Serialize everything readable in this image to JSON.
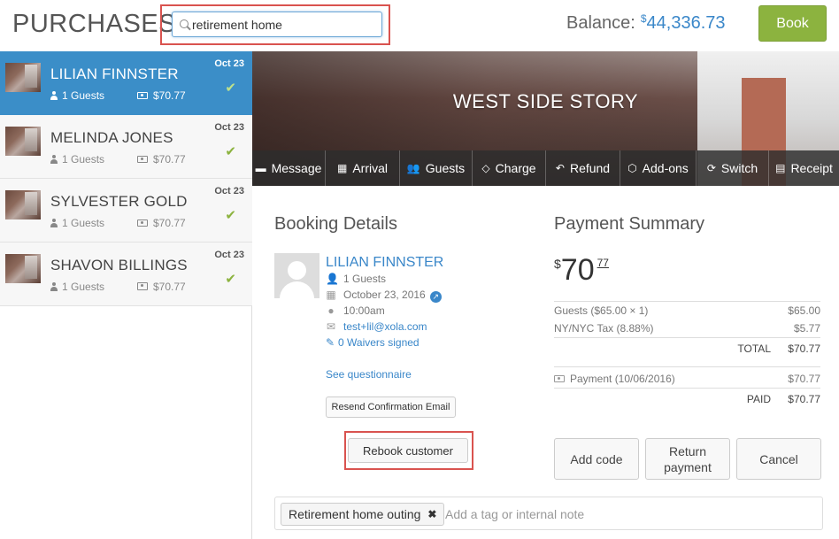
{
  "header": {
    "title": "PURCHASES",
    "search": {
      "value": "retirement home",
      "placeholder": ""
    },
    "balance_label": "Balance:",
    "balance_currency": "$",
    "balance_amount": "44,336.73",
    "book_label": "Book"
  },
  "purchases": [
    {
      "name": "LILIAN FINNSTER",
      "date": "Oct 23",
      "guests": "1 Guests",
      "price": "$70.77",
      "payment_icon": "cash-icon",
      "active": true
    },
    {
      "name": "MELINDA JONES",
      "date": "Oct 23",
      "guests": "1 Guests",
      "price": "$70.77",
      "payment_icon": "cash-icon",
      "active": false
    },
    {
      "name": "SYLVESTER GOLD",
      "date": "Oct 23",
      "guests": "1 Guests",
      "price": "$70.77",
      "payment_icon": "cash-icon",
      "active": false
    },
    {
      "name": "SHAVON BILLINGS",
      "date": "Oct 23",
      "guests": "1 Guests",
      "price": "$70.77",
      "payment_icon": "card-icon",
      "active": false
    }
  ],
  "experience": {
    "title": "WEST SIDE STORY"
  },
  "actions": [
    {
      "label": "Message",
      "icon": "speech-bubble-icon",
      "glyph": "▬"
    },
    {
      "label": "Arrival",
      "icon": "grid-icon",
      "glyph": "▦"
    },
    {
      "label": "Guests",
      "icon": "users-icon",
      "glyph": "👥"
    },
    {
      "label": "Charge",
      "icon": "tag-icon",
      "glyph": "◇"
    },
    {
      "label": "Refund",
      "icon": "undo-icon",
      "glyph": "↶"
    },
    {
      "label": "Add-ons",
      "icon": "cube-icon",
      "glyph": "⬡"
    },
    {
      "label": "Switch",
      "icon": "refresh-icon",
      "glyph": "⟳"
    },
    {
      "label": "Receipt",
      "icon": "receipt-icon",
      "glyph": "▤"
    }
  ],
  "booking": {
    "section_title": "Booking Details",
    "customer_name": "LILIAN FINNSTER",
    "guests": "1 Guests",
    "date": "October 23, 2016",
    "time": "10:00am",
    "email": "test+lil@xola.com",
    "waivers": "0 Waivers signed",
    "questionnaire": "See questionnaire",
    "resend_label": "Resend Confirmation Email",
    "rebook_label": "Rebook customer"
  },
  "payment": {
    "section_title": "Payment Summary",
    "currency": "$",
    "total_whole": "70",
    "total_cents": "77",
    "lines": [
      {
        "label": "Guests ($65.00 × 1)",
        "amount": "$65.00"
      },
      {
        "label": "NY/NYC Tax (8.88%)",
        "amount": "$5.77"
      }
    ],
    "total_label": "TOTAL",
    "total_amount": "$70.77",
    "payment_line": {
      "label": "Payment (10/06/2016)",
      "amount": "$70.77"
    },
    "paid_label": "PAID",
    "paid_amount": "$70.77",
    "buttons": {
      "add_code": "Add code",
      "return_payment_1": "Return",
      "return_payment_2": "payment",
      "cancel": "Cancel"
    }
  },
  "tags": {
    "chip": "Retirement home outing",
    "placeholder": "Add a tag or internal note"
  },
  "colors": {
    "accent": "#3b8ec8",
    "book_button": "#8cb33f",
    "highlight_box": "#d9534f",
    "check": "#8cb33f"
  }
}
